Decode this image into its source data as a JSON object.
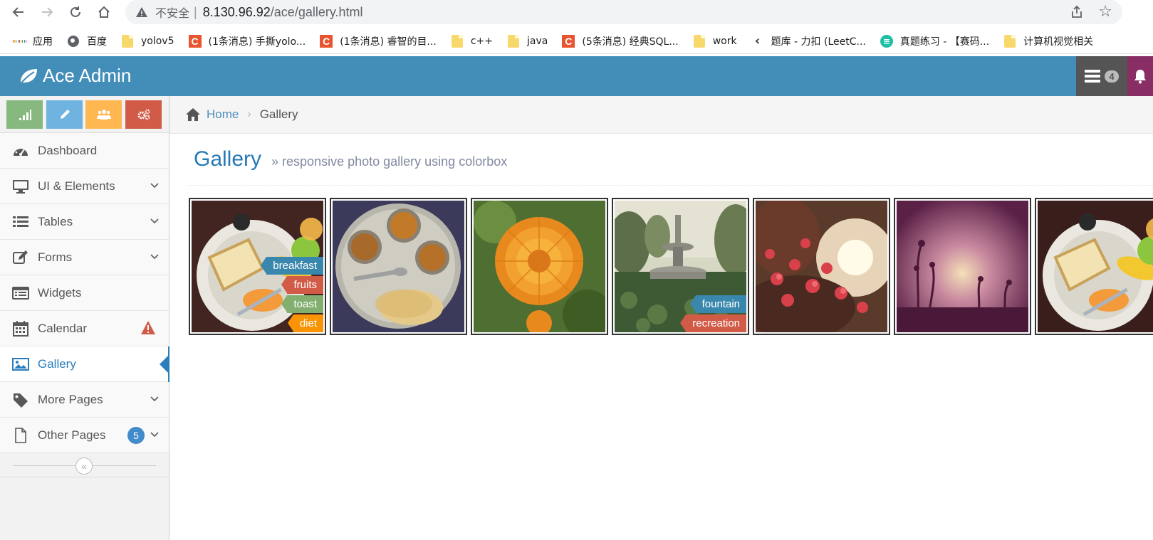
{
  "browser": {
    "insecure_label": "不安全",
    "url_host": "8.130.96.92",
    "url_path": "/ace/gallery.html",
    "bookmarks": [
      {
        "label": "应用",
        "icon": "apps-grid-icon"
      },
      {
        "label": "百度",
        "icon": "globe-icon"
      },
      {
        "label": "yolov5",
        "icon": "folder-icon"
      },
      {
        "label": "(1条消息) 手撕yolo...",
        "icon": "csdn-icon"
      },
      {
        "label": "(1条消息) 睿智的目...",
        "icon": "csdn-icon"
      },
      {
        "label": "c++",
        "icon": "folder-icon"
      },
      {
        "label": "java",
        "icon": "folder-icon"
      },
      {
        "label": "(5条消息) 经典SQL...",
        "icon": "csdn-icon"
      },
      {
        "label": "work",
        "icon": "folder-icon"
      },
      {
        "label": "题库 - 力扣 (LeetC...",
        "icon": "leetcode-icon"
      },
      {
        "label": "真题练习 - 【赛码...",
        "icon": "saima-icon"
      },
      {
        "label": "计算机视觉相关",
        "icon": "folder-icon"
      }
    ]
  },
  "navbar": {
    "brand": "Ace Admin",
    "tasks_count": "4"
  },
  "sidebar": {
    "items": [
      {
        "label": "Dashboard",
        "icon": "dashboard-icon"
      },
      {
        "label": "UI & Elements",
        "icon": "desktop-icon"
      },
      {
        "label": "Tables",
        "icon": "list-icon"
      },
      {
        "label": "Forms",
        "icon": "edit-icon"
      },
      {
        "label": "Widgets",
        "icon": "widgets-icon"
      },
      {
        "label": "Calendar",
        "icon": "calendar-icon"
      },
      {
        "label": "Gallery",
        "icon": "picture-icon"
      },
      {
        "label": "More Pages",
        "icon": "tag-icon"
      },
      {
        "label": "Other Pages",
        "icon": "file-icon",
        "badge": "5"
      }
    ],
    "active": "Gallery",
    "shortcut_colors": [
      "#87b87f",
      "#6fb3e0",
      "#ffb752",
      "#d15b47"
    ]
  },
  "breadcrumb": {
    "home": "Home",
    "current": "Gallery"
  },
  "page": {
    "title": "Gallery",
    "subtitle": "» responsive photo gallery using colorbox"
  },
  "gallery": {
    "thumbs": [
      {
        "subject": "breakfast plate",
        "tags": [
          "breakfast",
          "fruits",
          "toast",
          "diet"
        ]
      },
      {
        "subject": "thali meal",
        "tags": []
      },
      {
        "subject": "orange flower",
        "tags": []
      },
      {
        "subject": "park fountain",
        "tags": [
          "fountain",
          "recreation"
        ]
      },
      {
        "subject": "red flowers at sunset",
        "tags": []
      },
      {
        "subject": "purple sunset",
        "tags": []
      },
      {
        "subject": "breakfast plate",
        "tags": []
      }
    ]
  },
  "colors": {
    "navbar": "#438eb9",
    "accent": "#2b7dbc",
    "tag_blue": "#3a87ad",
    "tag_red": "#d15b47",
    "tag_green": "#82af6f",
    "tag_orange": "#f89406"
  }
}
